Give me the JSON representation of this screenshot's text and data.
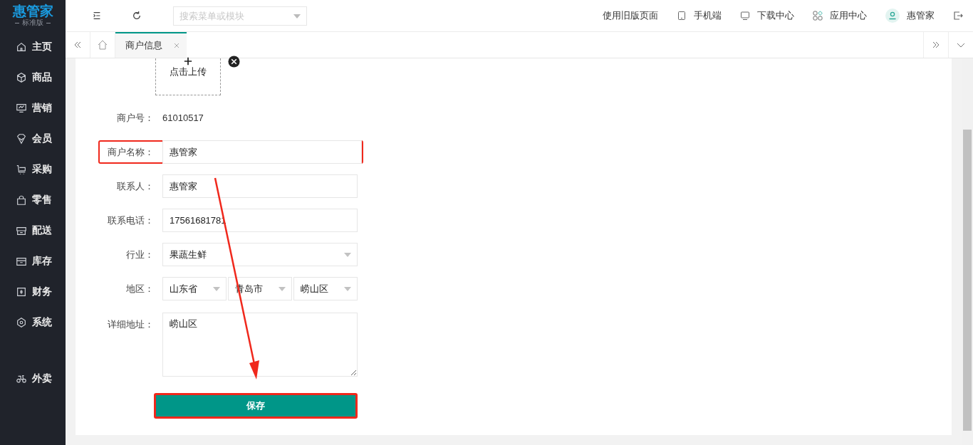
{
  "logo": {
    "name": "惠管家",
    "edition": "标准版"
  },
  "sidebar": {
    "items": [
      {
        "label": "主页"
      },
      {
        "label": "商品"
      },
      {
        "label": "营销"
      },
      {
        "label": "会员"
      },
      {
        "label": "采购"
      },
      {
        "label": "零售"
      },
      {
        "label": "配送"
      },
      {
        "label": "库存"
      },
      {
        "label": "财务"
      },
      {
        "label": "系统"
      }
    ],
    "extra_items": [
      {
        "label": "外卖"
      }
    ]
  },
  "topbar": {
    "search": {
      "placeholder": "搜索菜单或模块"
    },
    "links": [
      "使用旧版页面",
      "手机端",
      "下载中心",
      "应用中心"
    ],
    "user": "惠管家"
  },
  "tabs": [
    {
      "label": "商户信息",
      "selected": true
    }
  ],
  "upload": {
    "label": "点击上传"
  },
  "form": [
    {
      "kind": "text",
      "label": "商户号：",
      "value": "61010517",
      "highlighted": false
    },
    {
      "kind": "input",
      "label": "商户名称：",
      "value": "惠管家",
      "highlighted": true
    },
    {
      "kind": "input",
      "label": "联系人：",
      "value": "惠管家",
      "highlighted": false
    },
    {
      "kind": "input",
      "label": "联系电话：",
      "value": "17561681781",
      "highlighted": false
    },
    {
      "kind": "select",
      "label": "行业：",
      "values": [
        "果蔬生鲜"
      ],
      "highlighted": false
    },
    {
      "kind": "select",
      "label": "地区：",
      "values": [
        "山东省",
        "青岛市",
        "崂山区"
      ],
      "highlighted": false
    },
    {
      "kind": "textarea",
      "label": "详细地址：",
      "value": "崂山区",
      "highlighted": false
    }
  ],
  "save_button": {
    "label": "保存",
    "highlighted": true
  }
}
